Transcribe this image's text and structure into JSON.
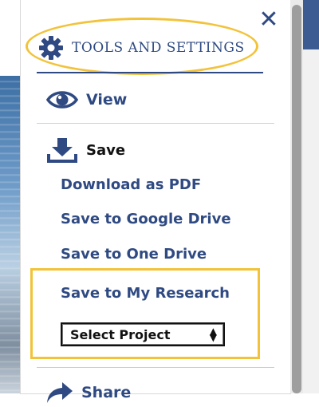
{
  "panel": {
    "title": "TOOLS AND SETTINGS",
    "close_icon": "close-icon",
    "sections": {
      "view": {
        "label": "View",
        "icon": "eye-icon"
      },
      "save": {
        "label": "Save",
        "icon": "download-icon"
      },
      "share": {
        "label": "Share",
        "icon": "share-icon"
      }
    },
    "save_options": {
      "download_pdf": "Download as PDF",
      "google_drive": "Save to Google Drive",
      "one_drive": "Save to One Drive",
      "my_research": "Save to My Research"
    },
    "project_select": {
      "selected": "Select Project"
    }
  },
  "colors": {
    "accent": "#2f4a82",
    "highlight": "#f2c33a"
  }
}
